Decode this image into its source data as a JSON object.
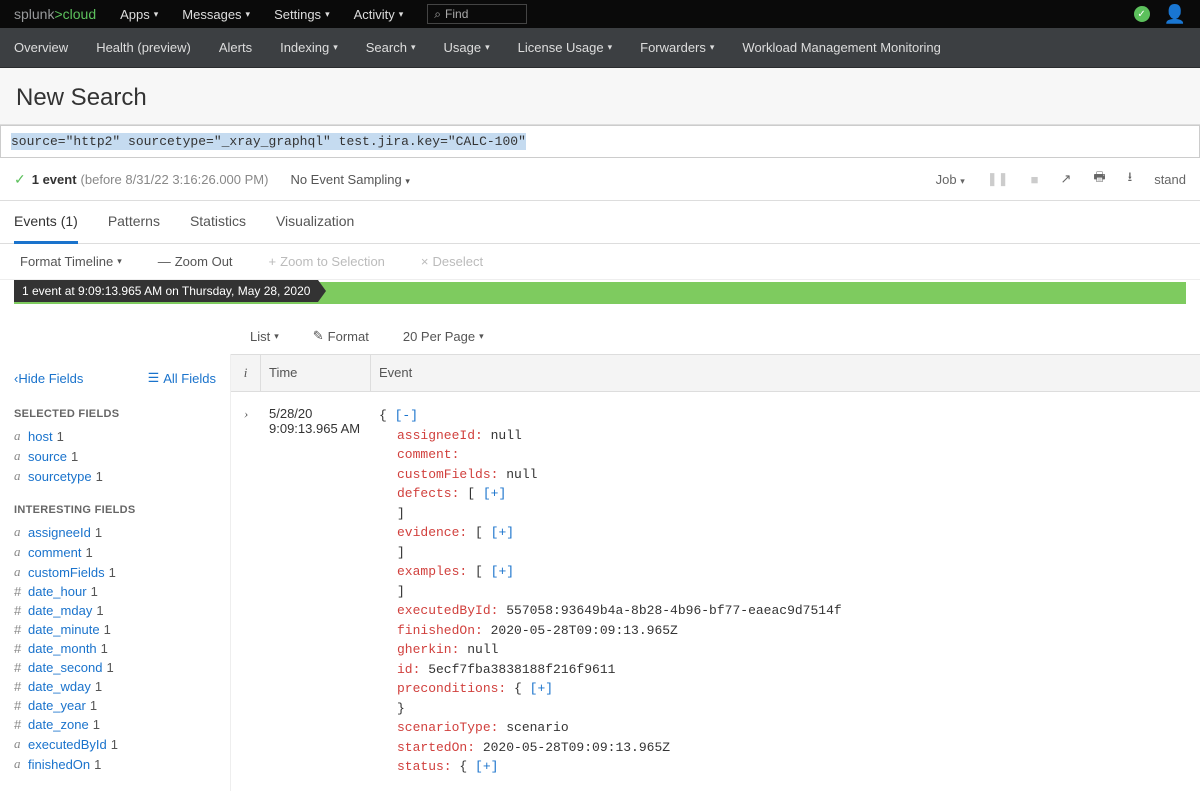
{
  "topnav": {
    "logo1": "splunk",
    "logo2": ">",
    "logo3": "cloud",
    "items": [
      "Apps",
      "Messages",
      "Settings",
      "Activity"
    ],
    "searchPlaceholder": "Find"
  },
  "subnav": {
    "items": [
      {
        "label": "Overview",
        "caret": false
      },
      {
        "label": "Health (preview)",
        "caret": false
      },
      {
        "label": "Alerts",
        "caret": false
      },
      {
        "label": "Indexing",
        "caret": true
      },
      {
        "label": "Search",
        "caret": true
      },
      {
        "label": "Usage",
        "caret": true
      },
      {
        "label": "License Usage",
        "caret": true
      },
      {
        "label": "Forwarders",
        "caret": true
      },
      {
        "label": "Workload Management Monitoring",
        "caret": false
      }
    ]
  },
  "page": {
    "title": "New Search"
  },
  "search": {
    "query": "source=\"http2\"  sourcetype=\"_xray_graphql\" test.jira.key=\"CALC-100\""
  },
  "resultbar": {
    "count": "1 event",
    "timerange": "(before 8/31/22 3:16:26.000 PM)",
    "sampling": "No Event Sampling",
    "job": "Job",
    "mode": "stand"
  },
  "tabs": {
    "events": "Events (1)",
    "patterns": "Patterns",
    "statistics": "Statistics",
    "viz": "Visualization"
  },
  "tlcontrols": {
    "format": "Format Timeline",
    "zoomout": "Zoom Out",
    "zoomsel": "Zoom to Selection",
    "deselect": "Deselect"
  },
  "tl": {
    "tooltip": "1 event at 9:09:13.965 AM on Thursday, May 28, 2020"
  },
  "listcontrols": {
    "list": "List",
    "format": "Format",
    "perpage": "20 Per Page"
  },
  "sidebar": {
    "hide": "Hide Fields",
    "all": "All Fields",
    "selectedHdr": "SELECTED FIELDS",
    "interestingHdr": "INTERESTING FIELDS",
    "selected": [
      {
        "t": "a",
        "n": "host",
        "c": "1"
      },
      {
        "t": "a",
        "n": "source",
        "c": "1"
      },
      {
        "t": "a",
        "n": "sourcetype",
        "c": "1"
      }
    ],
    "interesting": [
      {
        "t": "a",
        "n": "assigneeId",
        "c": "1"
      },
      {
        "t": "a",
        "n": "comment",
        "c": "1"
      },
      {
        "t": "a",
        "n": "customFields",
        "c": "1"
      },
      {
        "t": "#",
        "n": "date_hour",
        "c": "1"
      },
      {
        "t": "#",
        "n": "date_mday",
        "c": "1"
      },
      {
        "t": "#",
        "n": "date_minute",
        "c": "1"
      },
      {
        "t": "#",
        "n": "date_month",
        "c": "1"
      },
      {
        "t": "#",
        "n": "date_second",
        "c": "1"
      },
      {
        "t": "#",
        "n": "date_wday",
        "c": "1"
      },
      {
        "t": "#",
        "n": "date_year",
        "c": "1"
      },
      {
        "t": "#",
        "n": "date_zone",
        "c": "1"
      },
      {
        "t": "a",
        "n": "executedById",
        "c": "1"
      },
      {
        "t": "a",
        "n": "finishedOn",
        "c": "1"
      }
    ]
  },
  "table": {
    "hdr_i": "i",
    "hdr_time": "Time",
    "hdr_event": "Event"
  },
  "event": {
    "date": "5/28/20",
    "time": "9:09:13.965 AM",
    "lines": [
      {
        "pre": "{ ",
        "k": "",
        "brL": "[-]",
        "brR": ""
      },
      {
        "k": "assigneeId",
        "v": " null"
      },
      {
        "k": "comment",
        "v": ""
      },
      {
        "k": "customFields",
        "v": " null"
      },
      {
        "k": "defects",
        "v": "",
        "arr": true
      },
      {
        "close": "]"
      },
      {
        "k": "evidence",
        "v": "",
        "arr": true
      },
      {
        "close": "]"
      },
      {
        "k": "examples",
        "v": "",
        "arr": true
      },
      {
        "close": "]"
      },
      {
        "k": "executedById",
        "v": " 557058:93649b4a-8b28-4b96-bf77-eaeac9d7514f"
      },
      {
        "k": "finishedOn",
        "v": " 2020-05-28T09:09:13.965Z"
      },
      {
        "k": "gherkin",
        "v": " null"
      },
      {
        "k": "id",
        "v": " 5ecf7fba3838188f216f9611"
      },
      {
        "k": "preconditions",
        "v": "",
        "obj": true
      },
      {
        "close": "}"
      },
      {
        "k": "scenarioType",
        "v": " scenario"
      },
      {
        "k": "startedOn",
        "v": " 2020-05-28T09:09:13.965Z"
      },
      {
        "k": "status",
        "v": "",
        "obj": true
      }
    ]
  }
}
